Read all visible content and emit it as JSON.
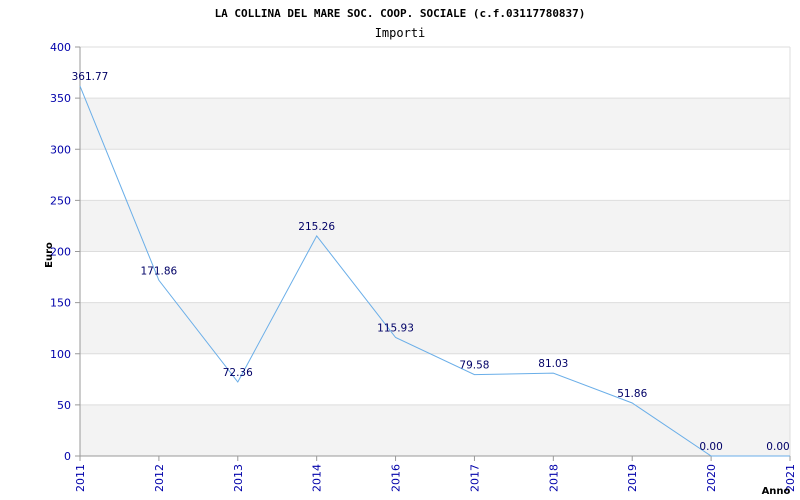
{
  "chart_data": {
    "type": "line",
    "title": "LA COLLINA DEL MARE SOC. COOP. SOCIALE (c.f.03117780837)",
    "subtitle": "Importi",
    "xlabel": "Anno",
    "ylabel": "Euro",
    "ylim": [
      0,
      400
    ],
    "yticks": [
      0,
      50,
      100,
      150,
      200,
      250,
      300,
      350,
      400
    ],
    "grid": true,
    "categories": [
      "2011",
      "2012",
      "2013",
      "2014",
      "2016",
      "2017",
      "2018",
      "2019",
      "2020",
      "2021"
    ],
    "values": [
      361.77,
      171.86,
      72.36,
      215.26,
      115.93,
      79.58,
      81.03,
      51.86,
      0.0,
      0.0
    ],
    "value_labels": [
      "361.77",
      "171.86",
      "72.36",
      "215.26",
      "115.93",
      "79.58",
      "81.03",
      "51.86",
      "0.00",
      "0.00"
    ],
    "colors": {
      "line": "#6aaee8",
      "band": "#f3f3f3",
      "grid": "#dddddd",
      "axis": "#999999",
      "tick_text": "#0000aa",
      "label_text": "#000066"
    }
  }
}
